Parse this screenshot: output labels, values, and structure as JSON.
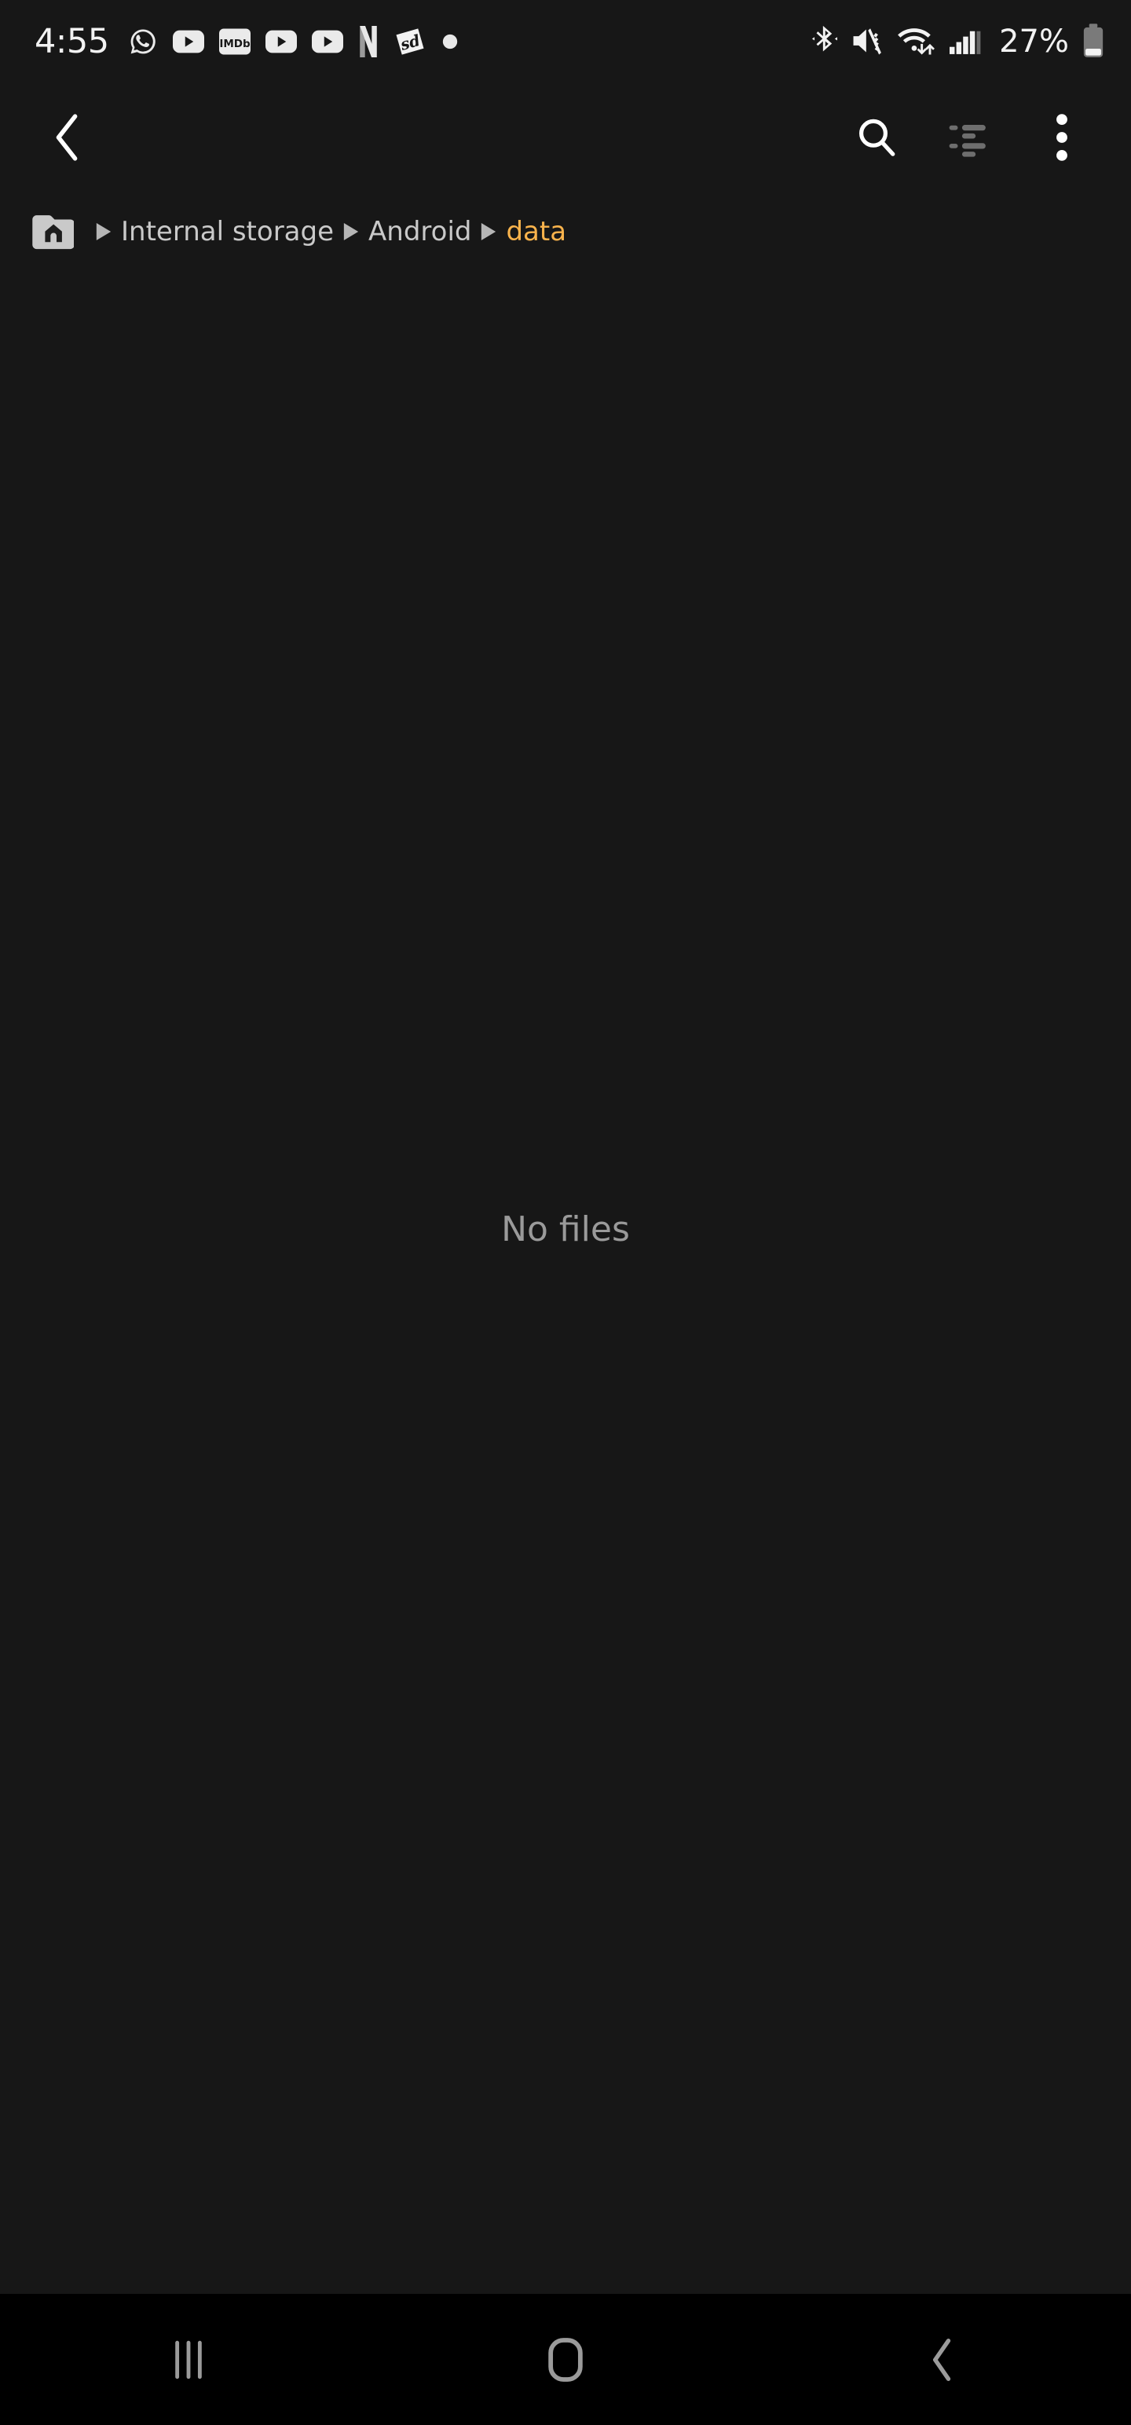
{
  "theme": {
    "background": "#171717",
    "navbar_background": "#000000",
    "primary_text": "#f2f2f2",
    "secondary_text": "#c9c9c9",
    "muted_text": "#9a9a9a",
    "accent": "#f9b34c",
    "disabled_icon": "#6e6e6e"
  },
  "status_bar": {
    "time": "4:55",
    "battery_percent": "27%",
    "notification_icons": [
      {
        "name": "whatsapp-icon",
        "label": "WhatsApp"
      },
      {
        "name": "youtube-icon",
        "label": "YouTube"
      },
      {
        "name": "imdb-icon",
        "label": "IMDb"
      },
      {
        "name": "youtube-icon",
        "label": "YouTube"
      },
      {
        "name": "youtube-icon",
        "label": "YouTube"
      },
      {
        "name": "netflix-icon",
        "label": "Netflix"
      },
      {
        "name": "snapchat-icon",
        "label": "sd"
      },
      {
        "name": "more-notifications-dot",
        "label": "More notifications"
      }
    ],
    "system_icons": [
      {
        "name": "bluetooth-icon",
        "label": "Bluetooth on"
      },
      {
        "name": "sound-vibrate-icon",
        "label": "Mute / vibrate"
      },
      {
        "name": "wifi-icon",
        "label": "Wi-Fi connected"
      },
      {
        "name": "signal-icon",
        "label": "Mobile signal"
      },
      {
        "name": "battery-icon",
        "label": "Battery 27%"
      }
    ]
  },
  "toolbar": {
    "back_label": "Back",
    "search_label": "Search",
    "view_label": "View as",
    "more_label": "More options"
  },
  "breadcrumb": {
    "home_label": "Internal storage home",
    "separator": "▶",
    "items": [
      {
        "label": "Internal storage",
        "current": false
      },
      {
        "label": "Android",
        "current": false
      },
      {
        "label": "data",
        "current": true
      }
    ]
  },
  "main": {
    "empty_message": "No files",
    "file_count": 0,
    "files": []
  },
  "navbar": {
    "recents_label": "Recents",
    "home_label": "Home",
    "back_label": "Back"
  }
}
